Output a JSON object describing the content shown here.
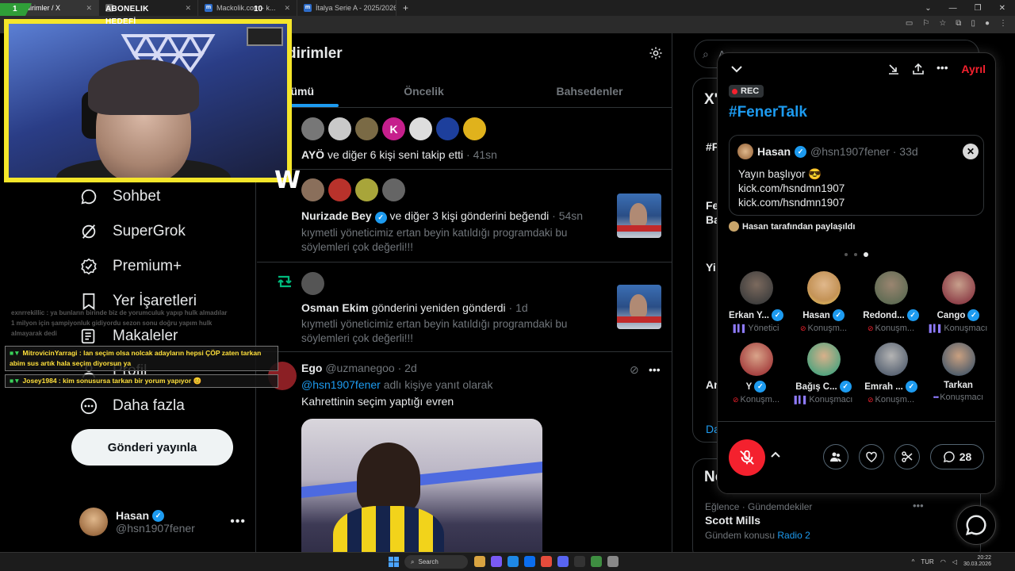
{
  "browser": {
    "tabs": [
      {
        "label": "Bildirimler / X",
        "active": true
      },
      {
        "label": "",
        "active": false
      },
      {
        "label": "Mackolik.com - k...",
        "active": false
      },
      {
        "label": "İtalya Serie A - 2025/2026 - Pu...",
        "active": false
      }
    ]
  },
  "stream_overlay": {
    "goal_current": "1",
    "goal_title": "ABONELIK HEDEFİ",
    "goal_target": "10",
    "logo": "W"
  },
  "chat": {
    "faded_lines": [
      "exnrrekillic : ya bunların birinde biz de yorumculuk yapıp hulk almadılar",
      "1 milyon için şampiyonluk gidiyordu sezon sonu doğru yapım hulk",
      "almayarak dedi"
    ],
    "messages": [
      {
        "user": "MitrovicinYarragi",
        "text": "lan seçim olsa nolcak adayların hepsi ÇÖP zaten tarkan abim sus artık hala seçim diyorsun ya"
      },
      {
        "user": "Josey1984",
        "text": "kim sonusursa tarkan bir yorum yapıyor 😊"
      }
    ]
  },
  "nav": {
    "items": [
      {
        "label": "Sohbet",
        "icon": "chat-bubble-icon"
      },
      {
        "label": "SuperGrok",
        "icon": "grok-icon"
      },
      {
        "label": "Premium+",
        "icon": "verified-badge-icon"
      },
      {
        "label": "Yer İşaretleri",
        "icon": "bookmark-icon"
      },
      {
        "label": "Makaleler",
        "icon": "article-icon"
      },
      {
        "label": "Profil",
        "icon": "profile-icon"
      },
      {
        "label": "Daha fazla",
        "icon": "more-circle-icon"
      }
    ],
    "post_button": "Gönderi yayınla",
    "profile": {
      "name": "Hasan",
      "handle": "@hsn1907fener"
    }
  },
  "feed": {
    "title": "dirimler",
    "tabs": [
      "Tümü",
      "Öncelik",
      "Bahsedenler"
    ],
    "follow_notif": {
      "name": "AYÖ",
      "text": " ve diğer 6 kişi seni takip etti",
      "time": " · 41sn"
    },
    "like_notif": {
      "name": "Nurizade Bey",
      "text": " ve diğer 3 kişi gönderini beğendi",
      "time": " · 54sn",
      "quote": "kıymetli yöneticimiz ertan beyin katıldığı programdaki bu söylemleri çok değerli!!!"
    },
    "repost_notif": {
      "name": "Osman Ekim",
      "text": " gönderini yeniden gönderdi",
      "time": " · 1d",
      "quote": "kıymetli yöneticimiz ertan beyin katıldığı programdaki bu söylemleri çok değerli!!!"
    },
    "post": {
      "name": "Ego",
      "handle": " @uzmanegoo · 2d",
      "reply_to": "@hsn1907fener",
      "reply_text": " adlı kişiye yanıt olarak",
      "body": "Kahrettinin seçim yaptığı evren"
    },
    "avatar_letter": "K"
  },
  "right": {
    "search_placeholder": "A",
    "section_letter": "X'",
    "fragments": [
      "#F",
      "Fe",
      "Ba",
      "Yi",
      "An",
      "Da",
      "No"
    ],
    "trend": {
      "category": "Eğlence · Gündemdekiler",
      "name": "Scott Mills",
      "sub_prefix": "Gündem konusu ",
      "sub_link": "Radio 2"
    }
  },
  "space": {
    "leave_label": "Ayrıl",
    "rec_label": "REC",
    "title": "#FenerTalk",
    "pinned": {
      "name": "Hasan",
      "handle": "@hsn1907fener · 33d",
      "lines": [
        "Yayın başlıyor 😎",
        "kick.com/hsndmn1907",
        "kick.com/hsndmn1907"
      ]
    },
    "shared_by": "Hasan tarafından paylaşıldı",
    "participants": [
      {
        "name": "Erkan Y...",
        "role": "Yönetici",
        "role_icon": "bars",
        "verified": true
      },
      {
        "name": "Hasan",
        "role": "Konuşm...",
        "role_icon": "mic-off",
        "verified": true
      },
      {
        "name": "Redond...",
        "role": "Konuşm...",
        "role_icon": "mic-off",
        "verified": true
      },
      {
        "name": "Cango",
        "role": "Konuşmacı",
        "role_icon": "bars",
        "verified": true
      },
      {
        "name": "Y",
        "role": "Konuşm...",
        "role_icon": "mic-off",
        "verified": true
      },
      {
        "name": "Bağış C...",
        "role": "Konuşmacı",
        "role_icon": "bars",
        "verified": true
      },
      {
        "name": "Emrah ...",
        "role": "Konuşm...",
        "role_icon": "mic-off",
        "verified": true
      },
      {
        "name": "Tarkan",
        "role": "Konuşmacı",
        "role_icon": "dots",
        "verified": false
      }
    ],
    "comments_count": "28"
  },
  "taskbar": {
    "search_placeholder": "Search",
    "lang": "TUR",
    "time": "20:22",
    "date": "30.03.2026"
  },
  "colors": {
    "accent": "#1d9bf0",
    "danger": "#f4212e",
    "overlay_yellow": "#f5e62a"
  }
}
